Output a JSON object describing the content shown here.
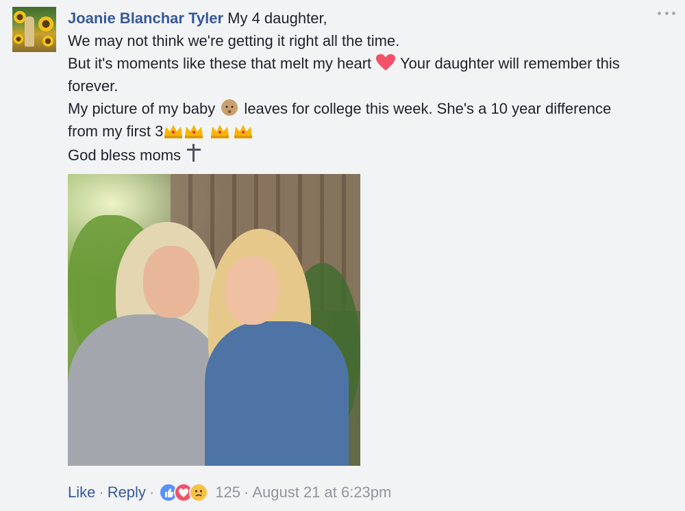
{
  "post": {
    "author": "Joanie Blanchar Tyler",
    "line1": " My 4 daughter,",
    "line2": "We may not think we're getting it right all the time.",
    "line3a": "But it's moments like these that melt my heart ",
    "line3b": " Your daughter will remember this",
    "line4": "forever.",
    "line5a": "My picture of my baby ",
    "line5b": " leaves for college this week. She's a 10 year difference",
    "line6": "from my first 3",
    "line7": "God bless moms "
  },
  "footer": {
    "like_label": "Like",
    "reply_label": "Reply",
    "separator": "·",
    "reaction_count": "125",
    "timestamp": "August 21 at 6:23pm"
  },
  "icons": {
    "heart": "red-heart-icon",
    "baby": "baby-icon",
    "crown": "crown-icon",
    "cross": "cross-icon",
    "more": "more-options-icon"
  },
  "colors": {
    "link": "#365899",
    "meta": "#90949c",
    "background": "#f2f3f5",
    "like_blue": "#5890ff",
    "love_red": "#f25268",
    "sad_yellow": "#f7c244"
  }
}
